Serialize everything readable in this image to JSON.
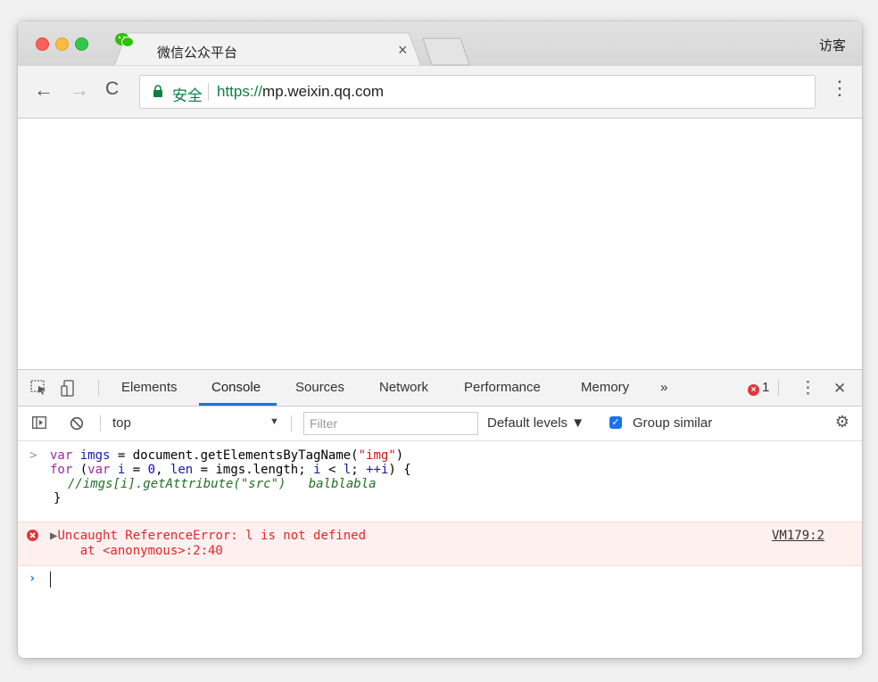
{
  "browser": {
    "tab_title": "微信公众平台",
    "tab_close": "×",
    "profile_label": "访客",
    "secure_label": "安全",
    "url_scheme": "https://",
    "url_host": "mp.weixin.qq.com",
    "back_glyph": "←",
    "forward_glyph": "→",
    "reload_glyph": "C",
    "menu_glyph": "⋮"
  },
  "devtools": {
    "tabs": [
      "Elements",
      "Console",
      "Sources",
      "Network",
      "Performance",
      "Memory"
    ],
    "active_tab": "Console",
    "more_tabs": "»",
    "error_count": "1",
    "menu_glyph": "⋮",
    "close_glyph": "✕",
    "context": "top",
    "filter_placeholder": "Filter",
    "levels_label": "Default levels ▼",
    "group_similar_label": "Group similar",
    "group_similar_checked": true
  },
  "console": {
    "prompt": ">",
    "code": {
      "line1": {
        "kw": "var",
        "var": "imgs",
        "mid": " = document.getElementsByTagName(",
        "str": "\"img\"",
        "end": ")"
      },
      "line2": {
        "kw_for": "for",
        "p1": " (",
        "kw_var": "var",
        "sp1": " ",
        "var_i": "i",
        "eq1": " = ",
        "zero": "0",
        "p2": ", ",
        "var_len": "len",
        "p3": " = imgs.length; ",
        "var_i2": "i",
        "p4": " < ",
        "var_l": "l",
        "p5": "; ",
        "var_inc": "++i",
        "end": ") {"
      },
      "line3": "//imgs[i].getAttribute(\"src\")   balblabla",
      "line4": "}"
    },
    "error": {
      "message": "Uncaught ReferenceError: l is not defined",
      "stack": "at <anonymous>:2:40",
      "source": "VM179:2"
    },
    "input_prompt": "›"
  },
  "colors": {
    "secure_green": "#0b8043",
    "accent_blue": "#1a73e8",
    "error_red": "#e0282b",
    "wechat_green": "#2dc100"
  }
}
